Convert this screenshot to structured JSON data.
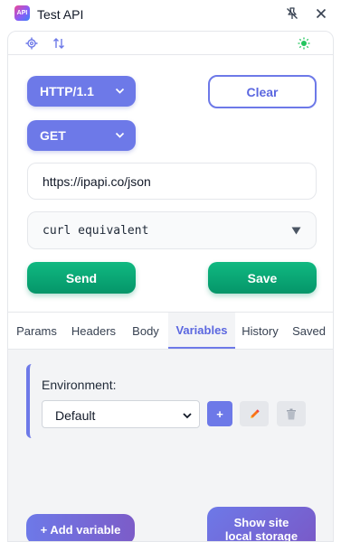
{
  "window": {
    "title": "Test API",
    "app_icon_text": "API"
  },
  "request": {
    "protocol": "HTTP/1.1",
    "method": "GET",
    "url": "https://ipapi.co/json",
    "curl_label": "curl equivalent",
    "clear_label": "Clear",
    "send_label": "Send",
    "save_label": "Save"
  },
  "tabs": [
    {
      "label": "Params"
    },
    {
      "label": "Headers"
    },
    {
      "label": "Body"
    },
    {
      "label": "Variables",
      "active": true
    },
    {
      "label": "History"
    },
    {
      "label": "Saved"
    }
  ],
  "variables": {
    "environment_label": "Environment:",
    "environment_value": "Default",
    "add_env_label": "+",
    "add_variable_label": "+ Add variable",
    "show_storage_line1": "Show site",
    "show_storage_line2": "local storage"
  },
  "colors": {
    "accent": "#6d79e8",
    "success": "#10b981",
    "theme_icon": "#22c55e"
  },
  "icons": [
    "gear-icon",
    "sort-arrows-icon",
    "sun-icon",
    "pin-off-icon",
    "close-icon",
    "chevron-down-icon",
    "pencil-icon",
    "trash-icon"
  ]
}
